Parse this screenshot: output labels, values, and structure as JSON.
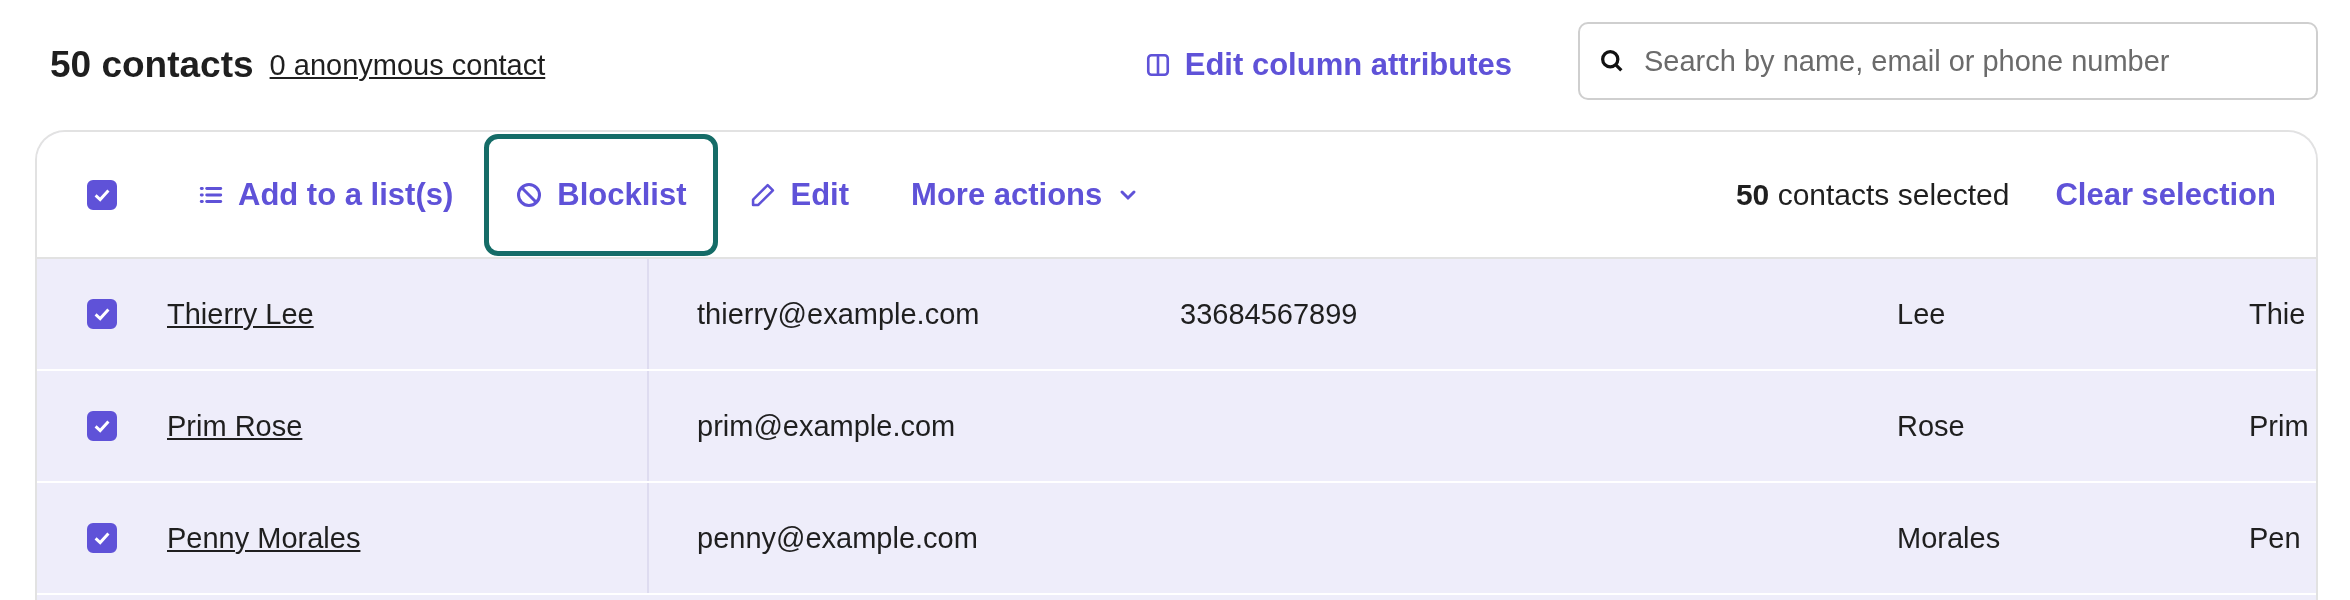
{
  "header": {
    "title": "50 contacts",
    "anonymous_link": "0 anonymous contact",
    "edit_columns": "Edit column attributes",
    "search": {
      "placeholder": "Search by name, email or phone number"
    }
  },
  "toolbar": {
    "select_all": {
      "checked": true
    },
    "actions": [
      {
        "kind": "list",
        "label": "Add to a list(s)",
        "focused": false
      },
      {
        "kind": "block",
        "label": "Blocklist",
        "focused": true
      },
      {
        "kind": "edit",
        "label": "Edit",
        "focused": false
      },
      {
        "kind": "more",
        "label": "More actions",
        "focused": false
      }
    ],
    "selection_summary": "**50** contacts selected",
    "clear_selection": "Clear selection"
  },
  "rows": [
    {
      "checked": true,
      "name": "Thierry Lee",
      "email": "thierry@example.com",
      "phone": "33684567899",
      "column_4": "Lee",
      "column_5": "Thie"
    },
    {
      "checked": true,
      "name": "Prim Rose",
      "email": "prim@example.com",
      "phone": "",
      "column_4": "Rose",
      "column_5": "Prim"
    },
    {
      "checked": true,
      "name": "Penny Morales",
      "email": "penny@example.com",
      "phone": "",
      "column_4": "Morales",
      "column_5": "Pen"
    }
  ]
}
